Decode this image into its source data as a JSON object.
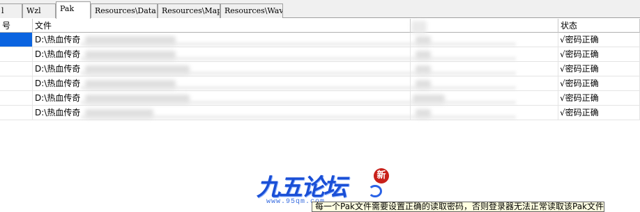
{
  "tabs": [
    {
      "label": "l",
      "active": false
    },
    {
      "label": "Wzl",
      "active": false
    },
    {
      "label": "Pak",
      "active": true
    },
    {
      "label": "Resources\\Data",
      "active": false
    },
    {
      "label": "Resources\\Map",
      "active": false
    },
    {
      "label": "Resources\\Wav",
      "active": false
    }
  ],
  "table": {
    "headers": {
      "index": "号",
      "file": "文件",
      "size": "",
      "status": "状态"
    },
    "rows": [
      {
        "index": "",
        "file": "D:\\热血传奇",
        "status": "√密码正确",
        "selected": true
      },
      {
        "index": "",
        "file": "D:\\热血传奇",
        "status": "√密码正确",
        "selected": false
      },
      {
        "index": "",
        "file": "D:\\热血传奇",
        "status": "√密码正确",
        "selected": false
      },
      {
        "index": "",
        "file": "D:\\热血传奇",
        "status": "√密码正确",
        "selected": false
      },
      {
        "index": "",
        "file": "D:\\热血传奇",
        "status": "√密码正确",
        "selected": false
      },
      {
        "index": "",
        "file": "D:\\热血传奇",
        "status": "√密码正确",
        "selected": false
      }
    ]
  },
  "watermark": {
    "logo_text": "九五论坛",
    "url": "www.95qm.com",
    "badge": "新"
  },
  "tooltip": "每一个Pak文件需要设置正确的读取密码，否则登录器无法正常读取该Pak文件",
  "colors": {
    "selection": "#0a64e0",
    "tooltip_bg": "#ffffe1",
    "logo_blue": "#1a4fd6"
  }
}
